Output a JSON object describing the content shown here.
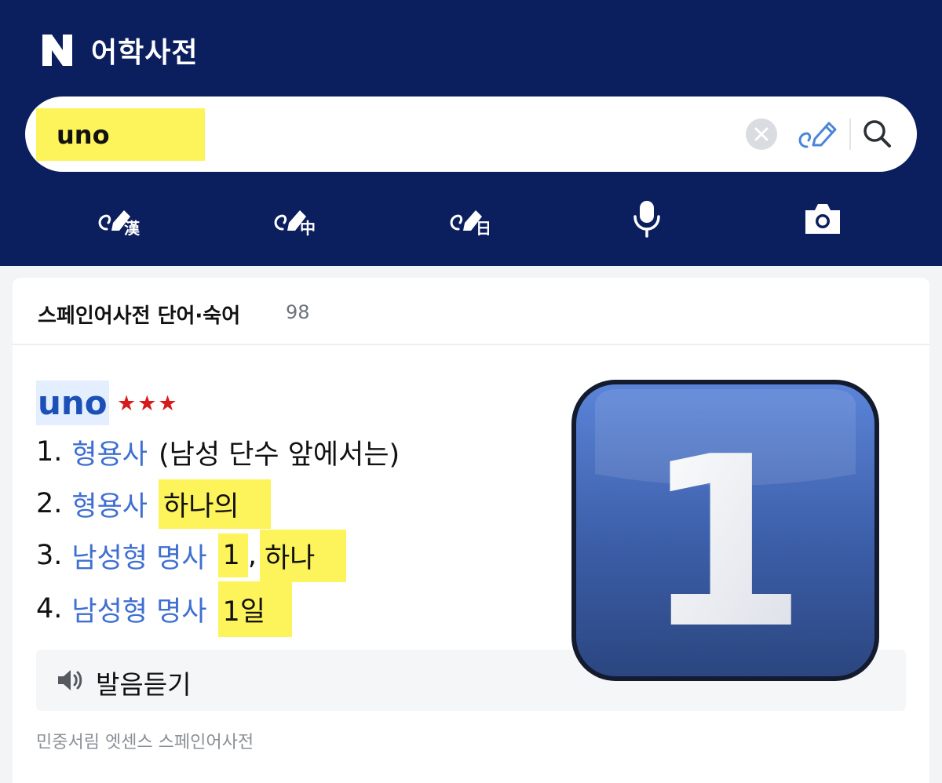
{
  "header": {
    "logo_letter": "N",
    "title": "어학사전"
  },
  "search": {
    "query": "uno",
    "buttons": [
      "clear-icon",
      "handwriting-icon",
      "search-icon"
    ]
  },
  "tools": [
    {
      "icon": "handwriting-hanja-icon",
      "label": "漢"
    },
    {
      "icon": "handwriting-chinese-icon",
      "label": "中"
    },
    {
      "icon": "handwriting-japanese-icon",
      "label": "日"
    },
    {
      "icon": "microphone-icon",
      "label": ""
    },
    {
      "icon": "camera-icon",
      "label": ""
    }
  ],
  "card": {
    "title": "스페인어사전 단어·숙어",
    "count": "98",
    "entry": {
      "word": "uno",
      "stars": "★★★",
      "definitions": [
        {
          "num": "1.",
          "pos": "형용사",
          "meaning": "(남성 단수 앞에서는)"
        },
        {
          "num": "2.",
          "pos": "형용사",
          "meaning": "하나의"
        },
        {
          "num": "3.",
          "pos": "남성형 명사",
          "meaning_a": "1",
          "sep": ",",
          "meaning_b": "하나"
        },
        {
          "num": "4.",
          "pos": "남성형 명사",
          "meaning": "1일"
        }
      ],
      "image": {
        "icon": "keycap-digit-one-emoji",
        "digit": "1"
      }
    },
    "listen_label": "발음듣기",
    "source": "민중서림 엣센스 스페인어사전"
  },
  "colors": {
    "header_bg": "#0b1f5f",
    "highlight": "#fdf35a",
    "pos_blue": "#3f6fd1",
    "star_red": "#d71a1a"
  }
}
